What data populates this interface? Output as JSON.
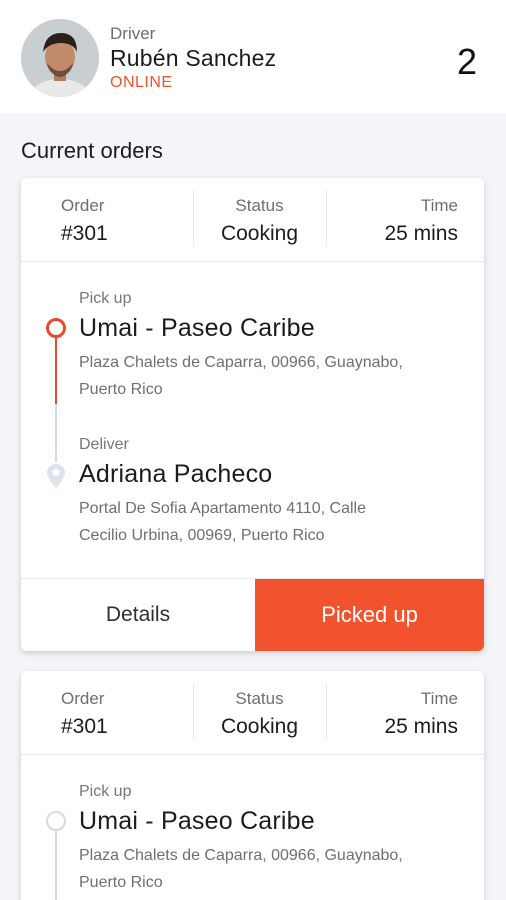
{
  "driver": {
    "role": "Driver",
    "name": "Rubén Sanchez",
    "status": "ONLINE",
    "order_count": "2"
  },
  "colors": {
    "accent": "#f0532d",
    "muted_track": "#d5dbe3"
  },
  "section_title": "Current orders",
  "orders": [
    {
      "order_label": "Order",
      "order_value": "#301",
      "status_label": "Status",
      "status_value": "Cooking",
      "time_label": "Time",
      "time_value": "25 mins",
      "pickup": {
        "label": "Pick up",
        "name": "Umai - Paseo Caribe",
        "address_line1": "Plaza Chalets de Caparra, 00966, Guaynabo,",
        "address_line2": "Puerto Rico"
      },
      "deliver": {
        "label": "Deliver",
        "name": "Adriana Pacheco",
        "address_line1": "Portal De Sofia Apartamento 4110, Calle",
        "address_line2": "Cecilio Urbina, 00969, Puerto Rico"
      },
      "details_label": "Details",
      "action_label": "Picked up"
    },
    {
      "order_label": "Order",
      "order_value": "#301",
      "status_label": "Status",
      "status_value": "Cooking",
      "time_label": "Time",
      "time_value": "25 mins",
      "pickup": {
        "label": "Pick up",
        "name": "Umai - Paseo Caribe",
        "address_line1": "Plaza Chalets de Caparra, 00966, Guaynabo,",
        "address_line2": "Puerto Rico"
      }
    }
  ]
}
